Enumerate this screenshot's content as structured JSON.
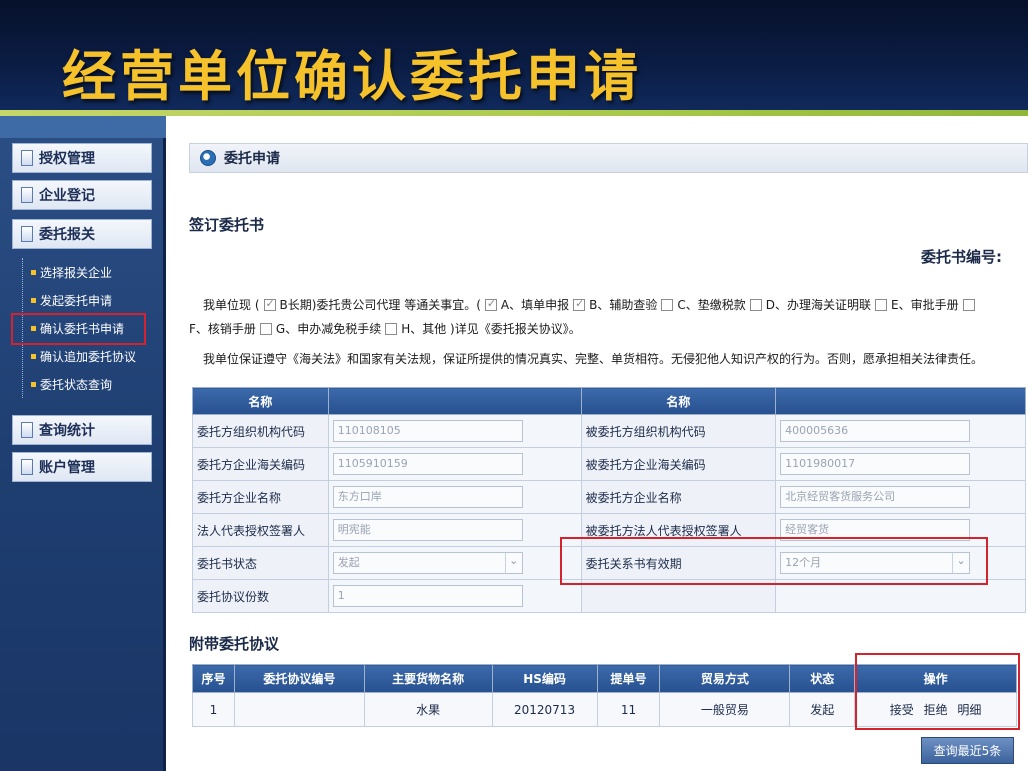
{
  "slide": {
    "title": "经营单位确认委托申请"
  },
  "sidebar": {
    "buttons": [
      "授权管理",
      "企业登记",
      "委托报关"
    ],
    "sub_items": [
      "选择报关企业",
      "发起委托申请",
      "确认委托书申请",
      "确认追加委托协议",
      "委托状态查询"
    ],
    "buttons_bottom": [
      "查询统计",
      "账户管理"
    ]
  },
  "panel": {
    "title": "委托申请"
  },
  "section": {
    "sign": "签订委托书",
    "book_no_label": "委托书编号:",
    "attach": "附带委托协议"
  },
  "declaration": {
    "prefix": "我单位现 (",
    "opt_long": "B长期)委托贵公司代理 等通关事宜。(",
    "opt_a": "A、填单申报",
    "opt_b": "B、辅助查验",
    "opt_c": "C、垫缴税款",
    "opt_d": "D、办理海关证明联",
    "opt_e": "E、审批手册",
    "opt_f": "F、核销手册",
    "opt_g": "G、申办减免税手续",
    "opt_h": "H、其他 )详见《委托报关协议》。",
    "line2": "我单位保证遵守《海关法》和国家有关法规，保证所提供的情况真实、完整、单货相符。无侵犯他人知识产权的行为。否则，愿承担相关法律责任。"
  },
  "info_table": {
    "headers": [
      "名称",
      "",
      "名称",
      ""
    ],
    "rows": [
      {
        "l1": "委托方组织机构代码",
        "v1": "110108105",
        "l2": "被委托方组织机构代码",
        "v2": "400005636"
      },
      {
        "l1": "委托方企业海关编码",
        "v1": "1105910159",
        "l2": "被委托方企业海关编码",
        "v2": "1101980017"
      },
      {
        "l1": "委托方企业名称",
        "v1": "东方口岸",
        "l2": "被委托方企业名称",
        "v2": "北京经贸客货服务公司"
      },
      {
        "l1": "法人代表授权签署人",
        "v1": "明宪能",
        "l2": "被委托方法人代表授权签署人",
        "v2": "经贸客货"
      },
      {
        "l1": "委托书状态",
        "v1": "发起",
        "l2": "委托关系书有效期",
        "v2": "12个月"
      },
      {
        "l1": "委托协议份数",
        "v1": "1",
        "l2": "",
        "v2": ""
      }
    ]
  },
  "attach_table": {
    "headers": [
      "序号",
      "委托协议编号",
      "主要货物名称",
      "HS编码",
      "提单号",
      "贸易方式",
      "状态",
      "操作"
    ],
    "row": {
      "no": "1",
      "agreement": "",
      "goods": "水果",
      "hs": "20120713",
      "bill": "11",
      "trade": "一般贸易",
      "status": "发起"
    },
    "ops": [
      "接受",
      "拒绝",
      "明细"
    ]
  },
  "query_button": "查询最近5条"
}
